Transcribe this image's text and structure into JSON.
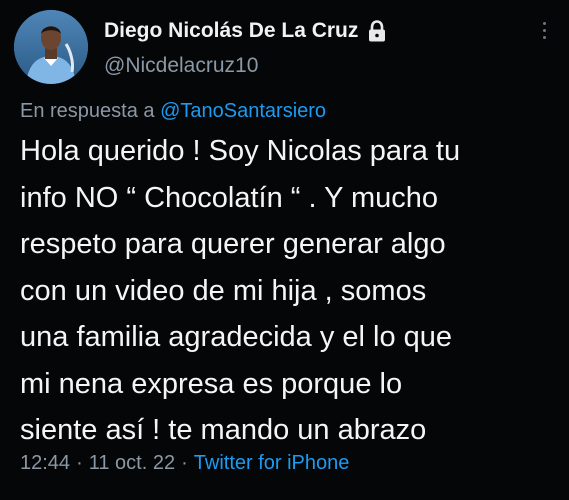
{
  "author": {
    "name": "Diego Nicolás De La Cruz",
    "handle": "@Nicdelacruz10"
  },
  "reply": {
    "prefix": "En respuesta a",
    "mention": "@TanoSantarsiero"
  },
  "tweet": {
    "lines": [
      "Hola querido ! Soy Nicolas para tu",
      "info NO “ Chocolatín “ . Y mucho",
      "respeto para querer generar algo",
      "con un video de mi hija , somos",
      "una familia agradecida y el lo que",
      "mi nena expresa es porque lo",
      "siente así ! te mando un abrazo"
    ]
  },
  "meta": {
    "time": "12:44",
    "date": "11 oct. 22",
    "separator": "·",
    "source": "Twitter for iPhone"
  },
  "icons": {
    "lock": "lock-icon",
    "more": "more-icon"
  },
  "colors": {
    "background": "#050608",
    "text": "#f5f5f5",
    "secondary": "#8b98a5",
    "link": "#1d9bf0"
  }
}
